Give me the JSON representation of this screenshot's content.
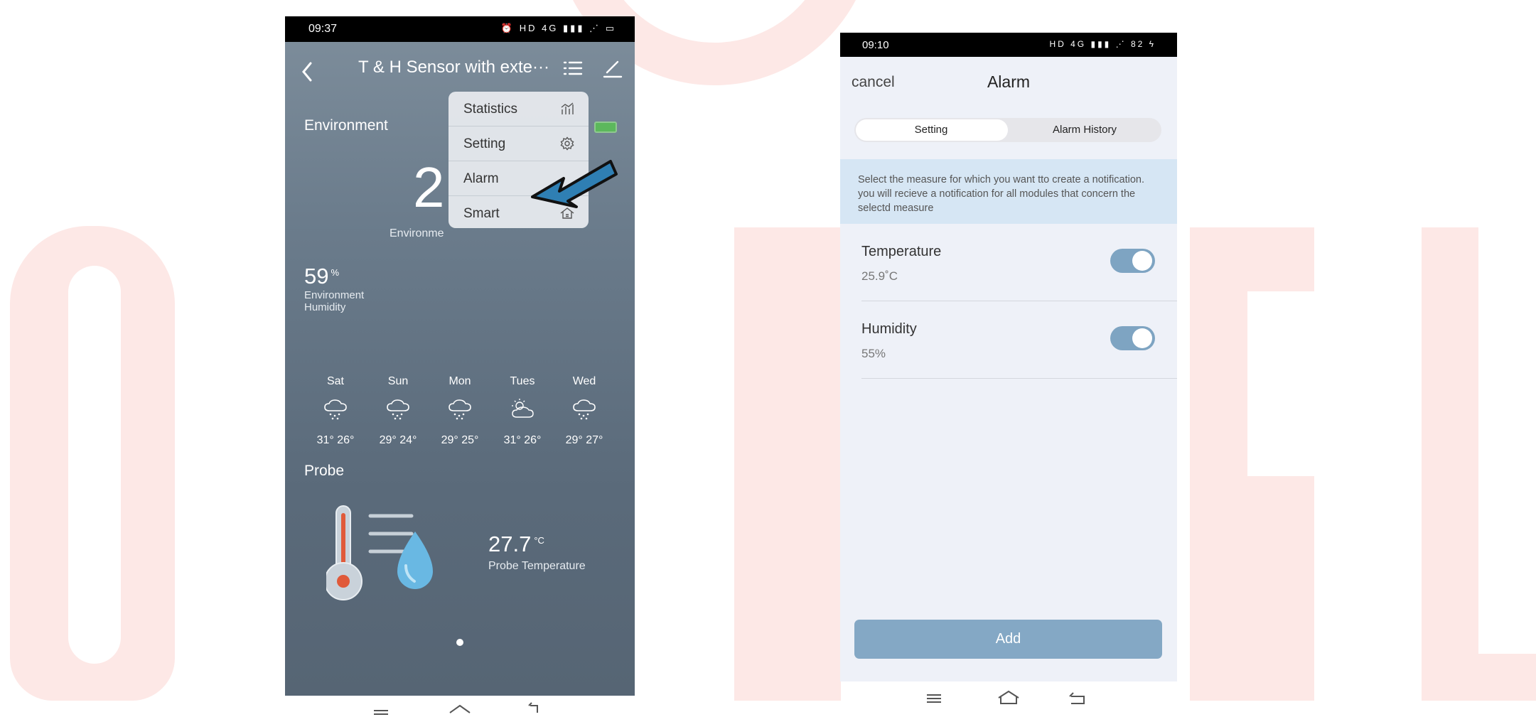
{
  "phone1": {
    "status_time": "09:37",
    "status_icons": "⏰ HD 4G ▮▮▮ ⋰ ▭",
    "title": "T & H Sensor with exte···",
    "environment_label": "Environment",
    "big_temp": "2",
    "env_temp_label": "Environme",
    "humidity_value": "59",
    "humidity_unit": "%",
    "humidity_label": "Environment Humidity",
    "menu": [
      {
        "label": "Statistics",
        "icon": "chart-icon"
      },
      {
        "label": "Setting",
        "icon": "gear-icon"
      },
      {
        "label": "Alarm",
        "icon": "none"
      },
      {
        "label": "Smart",
        "icon": "house-icon"
      }
    ],
    "forecast": [
      {
        "day": "Sat",
        "temps": "31°  26°",
        "icon": "snow-cloud-icon"
      },
      {
        "day": "Sun",
        "temps": "29°  24°",
        "icon": "snow-cloud-icon"
      },
      {
        "day": "Mon",
        "temps": "29°  25°",
        "icon": "snow-cloud-icon"
      },
      {
        "day": "Tues",
        "temps": "31°  26°",
        "icon": "sun-cloud-icon"
      },
      {
        "day": "Wed",
        "temps": "29°  27°",
        "icon": "snow-cloud-icon"
      }
    ],
    "probe_label": "Probe",
    "probe_value": "27.7",
    "probe_unit": "°C",
    "probe_caption": "Probe Temperature"
  },
  "phone2": {
    "status_time": "09:10",
    "status_icons": "HD 4G ▮▮▮ ⋰ 82 ϟ",
    "cancel": "cancel",
    "title": "Alarm",
    "tabs": [
      "Setting",
      "Alarm History"
    ],
    "info": "Select the measure for which you want tto create a notification. you will recieve a notification for all modules that concern the selectd measure",
    "rows": [
      {
        "title": "Temperature",
        "value": "25.9˚C",
        "enabled": true
      },
      {
        "title": "Humidity",
        "value": "55%",
        "enabled": true
      }
    ],
    "add_label": "Add"
  },
  "colors": {
    "accent": "#84a8c5",
    "toggle_on": "#7ea4c2",
    "watermark": "#fde8e6",
    "arrow": "#2f7fb3"
  }
}
